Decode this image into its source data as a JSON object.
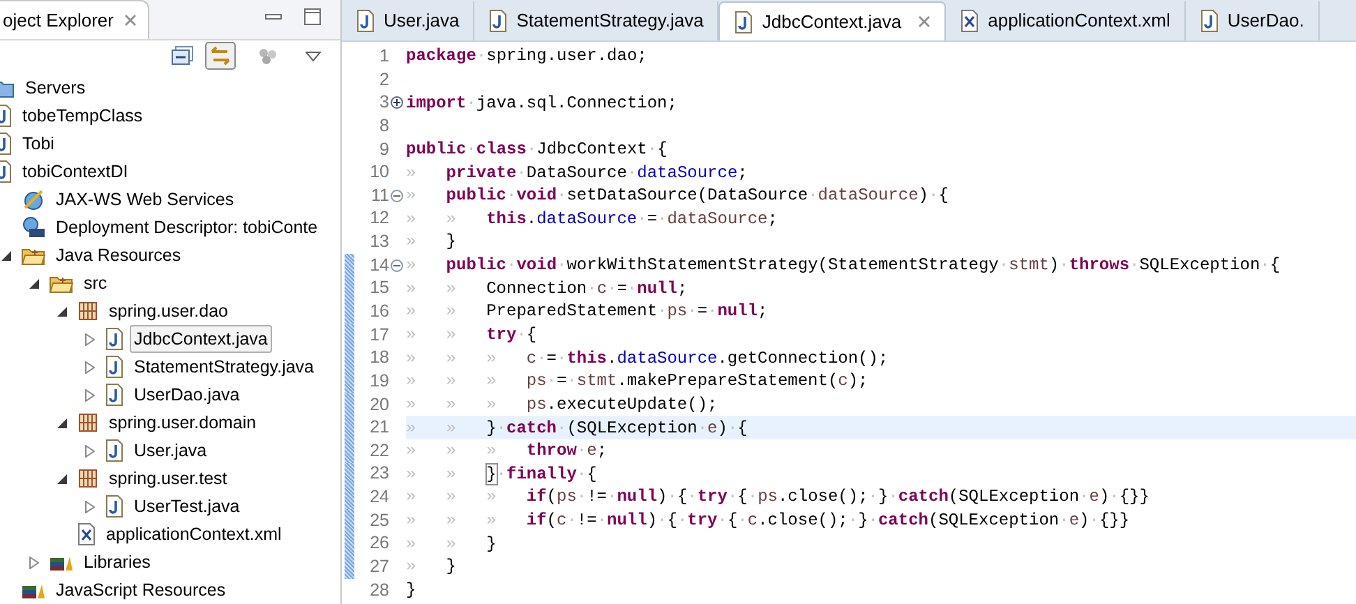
{
  "explorer": {
    "tab": {
      "label": "oject Explorer",
      "selected": true
    },
    "tree": [
      {
        "label": "Servers",
        "kind": "server"
      },
      {
        "label": "tobeTempClass",
        "kind": "project"
      },
      {
        "label": "Tobi",
        "kind": "project"
      },
      {
        "label": "tobiContextDI",
        "kind": "webproject",
        "children": [
          {
            "label": "JAX-WS Web Services",
            "kind": "webservice"
          },
          {
            "label": "Deployment Descriptor: tobiConte",
            "kind": "descriptor"
          },
          {
            "label": "Java Resources",
            "kind": "resources",
            "expanded": true,
            "children": [
              {
                "label": "src",
                "kind": "folder",
                "expanded": true,
                "children": [
                  {
                    "label": "spring.user.dao",
                    "kind": "package",
                    "expanded": true,
                    "children": [
                      {
                        "label": "JdbcContext.java",
                        "kind": "java",
                        "expanded": false,
                        "selected": true
                      },
                      {
                        "label": "StatementStrategy.java",
                        "kind": "java",
                        "expanded": false,
                        "selected": false
                      },
                      {
                        "label": "UserDao.java",
                        "kind": "java",
                        "expanded": false,
                        "selected": false
                      }
                    ]
                  },
                  {
                    "label": "spring.user.domain",
                    "kind": "package",
                    "expanded": true,
                    "children": [
                      {
                        "label": "User.java",
                        "kind": "java",
                        "expanded": false,
                        "selected": false
                      }
                    ]
                  },
                  {
                    "label": "spring.user.test",
                    "kind": "package",
                    "expanded": true,
                    "children": [
                      {
                        "label": "UserTest.java",
                        "kind": "java",
                        "expanded": false,
                        "selected": false
                      }
                    ]
                  },
                  {
                    "label": "applicationContext.xml",
                    "kind": "xml",
                    "selected": false
                  }
                ]
              },
              {
                "label": "Libraries",
                "kind": "library",
                "expanded": false
              }
            ]
          },
          {
            "label": "JavaScript Resources",
            "kind": "library"
          }
        ]
      }
    ]
  },
  "editor": {
    "tabs": [
      {
        "label": "User.java",
        "kind": "java",
        "selected": false
      },
      {
        "label": "StatementStrategy.java",
        "kind": "java",
        "selected": false
      },
      {
        "label": "JdbcContext.java",
        "kind": "java",
        "selected": true
      },
      {
        "label": "applicationContext.xml",
        "kind": "xml",
        "selected": false
      },
      {
        "label": "UserDao.",
        "kind": "java",
        "selected": false
      }
    ],
    "lines": [
      {
        "number": "1",
        "tokens": [
          {
            "kind": "keyword",
            "text": "package"
          },
          {
            "kind": "space",
            "text": "·"
          },
          {
            "kind": "plain",
            "text": "spring.user.dao;"
          }
        ]
      },
      {
        "number": "2"
      },
      {
        "number": "3",
        "folded": true,
        "tokens": [
          {
            "kind": "keyword",
            "text": "import"
          },
          {
            "kind": "space",
            "text": "·"
          },
          {
            "kind": "plain",
            "text": "java.sql.Connection;"
          }
        ]
      },
      {
        "number": "8"
      },
      {
        "number": "9",
        "tokens": [
          {
            "kind": "keyword",
            "text": "public"
          },
          {
            "kind": "space",
            "text": "·"
          },
          {
            "kind": "keyword",
            "text": "class"
          },
          {
            "kind": "space",
            "text": "·"
          },
          {
            "kind": "plain",
            "text": "JdbcContext"
          },
          {
            "kind": "space",
            "text": "·"
          },
          {
            "kind": "plain",
            "text": "{"
          }
        ]
      },
      {
        "number": "10",
        "tokens": [
          {
            "kind": "tab",
            "text": "»"
          },
          {
            "kind": "keyword",
            "text": "private"
          },
          {
            "kind": "space",
            "text": "·"
          },
          {
            "kind": "plain",
            "text": "DataSource"
          },
          {
            "kind": "space",
            "text": "·"
          },
          {
            "kind": "field",
            "text": "dataSource"
          },
          {
            "kind": "plain",
            "text": ";"
          }
        ]
      },
      {
        "number": "11",
        "folded": false,
        "tokens": [
          {
            "kind": "tab",
            "text": "»"
          },
          {
            "kind": "keyword",
            "text": "public"
          },
          {
            "kind": "space",
            "text": "·"
          },
          {
            "kind": "keyword",
            "text": "void"
          },
          {
            "kind": "space",
            "text": "·"
          },
          {
            "kind": "plain",
            "text": "setDataSource(DataSource"
          },
          {
            "kind": "space",
            "text": "·"
          },
          {
            "kind": "local",
            "text": "dataSource"
          },
          {
            "kind": "plain",
            "text": ")"
          },
          {
            "kind": "space",
            "text": "·"
          },
          {
            "kind": "plain",
            "text": "{"
          }
        ]
      },
      {
        "number": "12",
        "tokens": [
          {
            "kind": "tab",
            "text": "»"
          },
          {
            "kind": "tab",
            "text": "»"
          },
          {
            "kind": "keyword",
            "text": "this"
          },
          {
            "kind": "plain",
            "text": "."
          },
          {
            "kind": "field",
            "text": "dataSource"
          },
          {
            "kind": "space",
            "text": "·"
          },
          {
            "kind": "plain",
            "text": "="
          },
          {
            "kind": "space",
            "text": "·"
          },
          {
            "kind": "local",
            "text": "dataSource"
          },
          {
            "kind": "plain",
            "text": ";"
          }
        ]
      },
      {
        "number": "13",
        "tokens": [
          {
            "kind": "tab",
            "text": "»"
          },
          {
            "kind": "plain",
            "text": "}"
          }
        ]
      },
      {
        "number": "14",
        "folded": false,
        "changed": true,
        "tokens": [
          {
            "kind": "tab",
            "text": "»"
          },
          {
            "kind": "keyword",
            "text": "public"
          },
          {
            "kind": "space",
            "text": "·"
          },
          {
            "kind": "keyword",
            "text": "void"
          },
          {
            "kind": "space",
            "text": "·"
          },
          {
            "kind": "plain",
            "text": "workWithStatementStrategy(StatementStrategy"
          },
          {
            "kind": "space",
            "text": "·"
          },
          {
            "kind": "local",
            "text": "stmt"
          },
          {
            "kind": "plain",
            "text": ")"
          },
          {
            "kind": "space",
            "text": "·"
          },
          {
            "kind": "keyword",
            "text": "throws"
          },
          {
            "kind": "space",
            "text": "·"
          },
          {
            "kind": "plain",
            "text": "SQLException"
          },
          {
            "kind": "space",
            "text": "·"
          },
          {
            "kind": "plain",
            "text": "{"
          }
        ]
      },
      {
        "number": "15",
        "changed": true,
        "tokens": [
          {
            "kind": "tab",
            "text": "»"
          },
          {
            "kind": "tab",
            "text": "»"
          },
          {
            "kind": "plain",
            "text": "Connection"
          },
          {
            "kind": "space",
            "text": "·"
          },
          {
            "kind": "local",
            "text": "c"
          },
          {
            "kind": "space",
            "text": "·"
          },
          {
            "kind": "plain",
            "text": "="
          },
          {
            "kind": "space",
            "text": "·"
          },
          {
            "kind": "keyword",
            "text": "null"
          },
          {
            "kind": "plain",
            "text": ";"
          }
        ]
      },
      {
        "number": "16",
        "changed": true,
        "tokens": [
          {
            "kind": "tab",
            "text": "»"
          },
          {
            "kind": "tab",
            "text": "»"
          },
          {
            "kind": "plain",
            "text": "PreparedStatement"
          },
          {
            "kind": "space",
            "text": "·"
          },
          {
            "kind": "local",
            "text": "ps"
          },
          {
            "kind": "space",
            "text": "·"
          },
          {
            "kind": "plain",
            "text": "="
          },
          {
            "kind": "space",
            "text": "·"
          },
          {
            "kind": "keyword",
            "text": "null"
          },
          {
            "kind": "plain",
            "text": ";"
          }
        ]
      },
      {
        "number": "17",
        "changed": true,
        "tokens": [
          {
            "kind": "tab",
            "text": "»"
          },
          {
            "kind": "tab",
            "text": "»"
          },
          {
            "kind": "keyword",
            "text": "try"
          },
          {
            "kind": "space",
            "text": "·"
          },
          {
            "kind": "plain",
            "text": "{"
          }
        ]
      },
      {
        "number": "18",
        "changed": true,
        "tokens": [
          {
            "kind": "tab",
            "text": "»"
          },
          {
            "kind": "tab",
            "text": "»"
          },
          {
            "kind": "tab",
            "text": "»"
          },
          {
            "kind": "local",
            "text": "c"
          },
          {
            "kind": "space",
            "text": "·"
          },
          {
            "kind": "plain",
            "text": "="
          },
          {
            "kind": "space",
            "text": "·"
          },
          {
            "kind": "keyword",
            "text": "this"
          },
          {
            "kind": "plain",
            "text": "."
          },
          {
            "kind": "field",
            "text": "dataSource"
          },
          {
            "kind": "plain",
            "text": ".getConnection();"
          }
        ]
      },
      {
        "number": "19",
        "changed": true,
        "tokens": [
          {
            "kind": "tab",
            "text": "»"
          },
          {
            "kind": "tab",
            "text": "»"
          },
          {
            "kind": "tab",
            "text": "»"
          },
          {
            "kind": "local",
            "text": "ps"
          },
          {
            "kind": "space",
            "text": "·"
          },
          {
            "kind": "plain",
            "text": "="
          },
          {
            "kind": "space",
            "text": "·"
          },
          {
            "kind": "local",
            "text": "stmt"
          },
          {
            "kind": "plain",
            "text": ".makePrepareStatement("
          },
          {
            "kind": "local",
            "text": "c"
          },
          {
            "kind": "plain",
            "text": ");"
          }
        ]
      },
      {
        "number": "20",
        "changed": true,
        "tokens": [
          {
            "kind": "tab",
            "text": "»"
          },
          {
            "kind": "tab",
            "text": "»"
          },
          {
            "kind": "tab",
            "text": "»"
          },
          {
            "kind": "local",
            "text": "ps"
          },
          {
            "kind": "plain",
            "text": ".executeUpdate();"
          }
        ]
      },
      {
        "number": "21",
        "changed": true,
        "current": true,
        "tokens": [
          {
            "kind": "tab",
            "text": "»"
          },
          {
            "kind": "tab",
            "text": "»"
          },
          {
            "kind": "plain",
            "text": "}"
          },
          {
            "kind": "space",
            "text": "·"
          },
          {
            "kind": "keyword",
            "text": "catch"
          },
          {
            "kind": "space",
            "text": "·"
          },
          {
            "kind": "plain",
            "text": "(SQLException"
          },
          {
            "kind": "space",
            "text": "·"
          },
          {
            "kind": "local",
            "text": "e"
          },
          {
            "kind": "plain",
            "text": ")"
          },
          {
            "kind": "space",
            "text": "·"
          },
          {
            "kind": "plain",
            "text": "{"
          }
        ]
      },
      {
        "number": "22",
        "changed": true,
        "tokens": [
          {
            "kind": "tab",
            "text": "»"
          },
          {
            "kind": "tab",
            "text": "»"
          },
          {
            "kind": "tab",
            "text": "»"
          },
          {
            "kind": "keyword",
            "text": "throw"
          },
          {
            "kind": "space",
            "text": "·"
          },
          {
            "kind": "local",
            "text": "e"
          },
          {
            "kind": "plain",
            "text": ";"
          }
        ]
      },
      {
        "number": "23",
        "changed": true,
        "tokens": [
          {
            "kind": "tab",
            "text": "»"
          },
          {
            "kind": "tab",
            "text": "»"
          },
          {
            "kind": "bracket",
            "text": "}"
          },
          {
            "kind": "space",
            "text": "·"
          },
          {
            "kind": "keyword",
            "text": "finally"
          },
          {
            "kind": "space",
            "text": "·"
          },
          {
            "kind": "plain",
            "text": "{"
          }
        ]
      },
      {
        "number": "24",
        "changed": true,
        "tokens": [
          {
            "kind": "tab",
            "text": "»"
          },
          {
            "kind": "tab",
            "text": "»"
          },
          {
            "kind": "tab",
            "text": "»"
          },
          {
            "kind": "keyword",
            "text": "if"
          },
          {
            "kind": "plain",
            "text": "("
          },
          {
            "kind": "local",
            "text": "ps"
          },
          {
            "kind": "space",
            "text": "·"
          },
          {
            "kind": "plain",
            "text": "!="
          },
          {
            "kind": "space",
            "text": "·"
          },
          {
            "kind": "keyword",
            "text": "null"
          },
          {
            "kind": "plain",
            "text": ")"
          },
          {
            "kind": "space",
            "text": "·"
          },
          {
            "kind": "plain",
            "text": "{"
          },
          {
            "kind": "space",
            "text": "·"
          },
          {
            "kind": "keyword",
            "text": "try"
          },
          {
            "kind": "space",
            "text": "·"
          },
          {
            "kind": "plain",
            "text": "{"
          },
          {
            "kind": "space",
            "text": "·"
          },
          {
            "kind": "local",
            "text": "ps"
          },
          {
            "kind": "plain",
            "text": ".close();"
          },
          {
            "kind": "space",
            "text": "·"
          },
          {
            "kind": "plain",
            "text": "}"
          },
          {
            "kind": "space",
            "text": "·"
          },
          {
            "kind": "keyword",
            "text": "catch"
          },
          {
            "kind": "plain",
            "text": "(SQLException"
          },
          {
            "kind": "space",
            "text": "·"
          },
          {
            "kind": "local",
            "text": "e"
          },
          {
            "kind": "plain",
            "text": ")"
          },
          {
            "kind": "space",
            "text": "·"
          },
          {
            "kind": "plain",
            "text": "{}}"
          }
        ]
      },
      {
        "number": "25",
        "changed": true,
        "tokens": [
          {
            "kind": "tab",
            "text": "»"
          },
          {
            "kind": "tab",
            "text": "»"
          },
          {
            "kind": "tab",
            "text": "»"
          },
          {
            "kind": "keyword",
            "text": "if"
          },
          {
            "kind": "plain",
            "text": "("
          },
          {
            "kind": "local",
            "text": "c"
          },
          {
            "kind": "space",
            "text": "·"
          },
          {
            "kind": "plain",
            "text": "!="
          },
          {
            "kind": "space",
            "text": "·"
          },
          {
            "kind": "keyword",
            "text": "null"
          },
          {
            "kind": "plain",
            "text": ")"
          },
          {
            "kind": "space",
            "text": "·"
          },
          {
            "kind": "plain",
            "text": "{"
          },
          {
            "kind": "space",
            "text": "·"
          },
          {
            "kind": "keyword",
            "text": "try"
          },
          {
            "kind": "space",
            "text": "·"
          },
          {
            "kind": "plain",
            "text": "{"
          },
          {
            "kind": "space",
            "text": "·"
          },
          {
            "kind": "local",
            "text": "c"
          },
          {
            "kind": "plain",
            "text": ".close();"
          },
          {
            "kind": "space",
            "text": "·"
          },
          {
            "kind": "plain",
            "text": "}"
          },
          {
            "kind": "space",
            "text": "·"
          },
          {
            "kind": "keyword",
            "text": "catch"
          },
          {
            "kind": "plain",
            "text": "(SQLException"
          },
          {
            "kind": "space",
            "text": "·"
          },
          {
            "kind": "local",
            "text": "e"
          },
          {
            "kind": "plain",
            "text": ")"
          },
          {
            "kind": "space",
            "text": "·"
          },
          {
            "kind": "plain",
            "text": "{}}"
          }
        ]
      },
      {
        "number": "26",
        "changed": true,
        "tokens": [
          {
            "kind": "tab",
            "text": "»"
          },
          {
            "kind": "tab",
            "text": "»"
          },
          {
            "kind": "plain",
            "text": "}"
          }
        ]
      },
      {
        "number": "27",
        "changed": true,
        "tokens": [
          {
            "kind": "tab",
            "text": "»"
          },
          {
            "kind": "plain",
            "text": "}"
          }
        ]
      },
      {
        "number": "28",
        "tokens": [
          {
            "kind": "plain",
            "text": "}"
          }
        ]
      }
    ]
  }
}
